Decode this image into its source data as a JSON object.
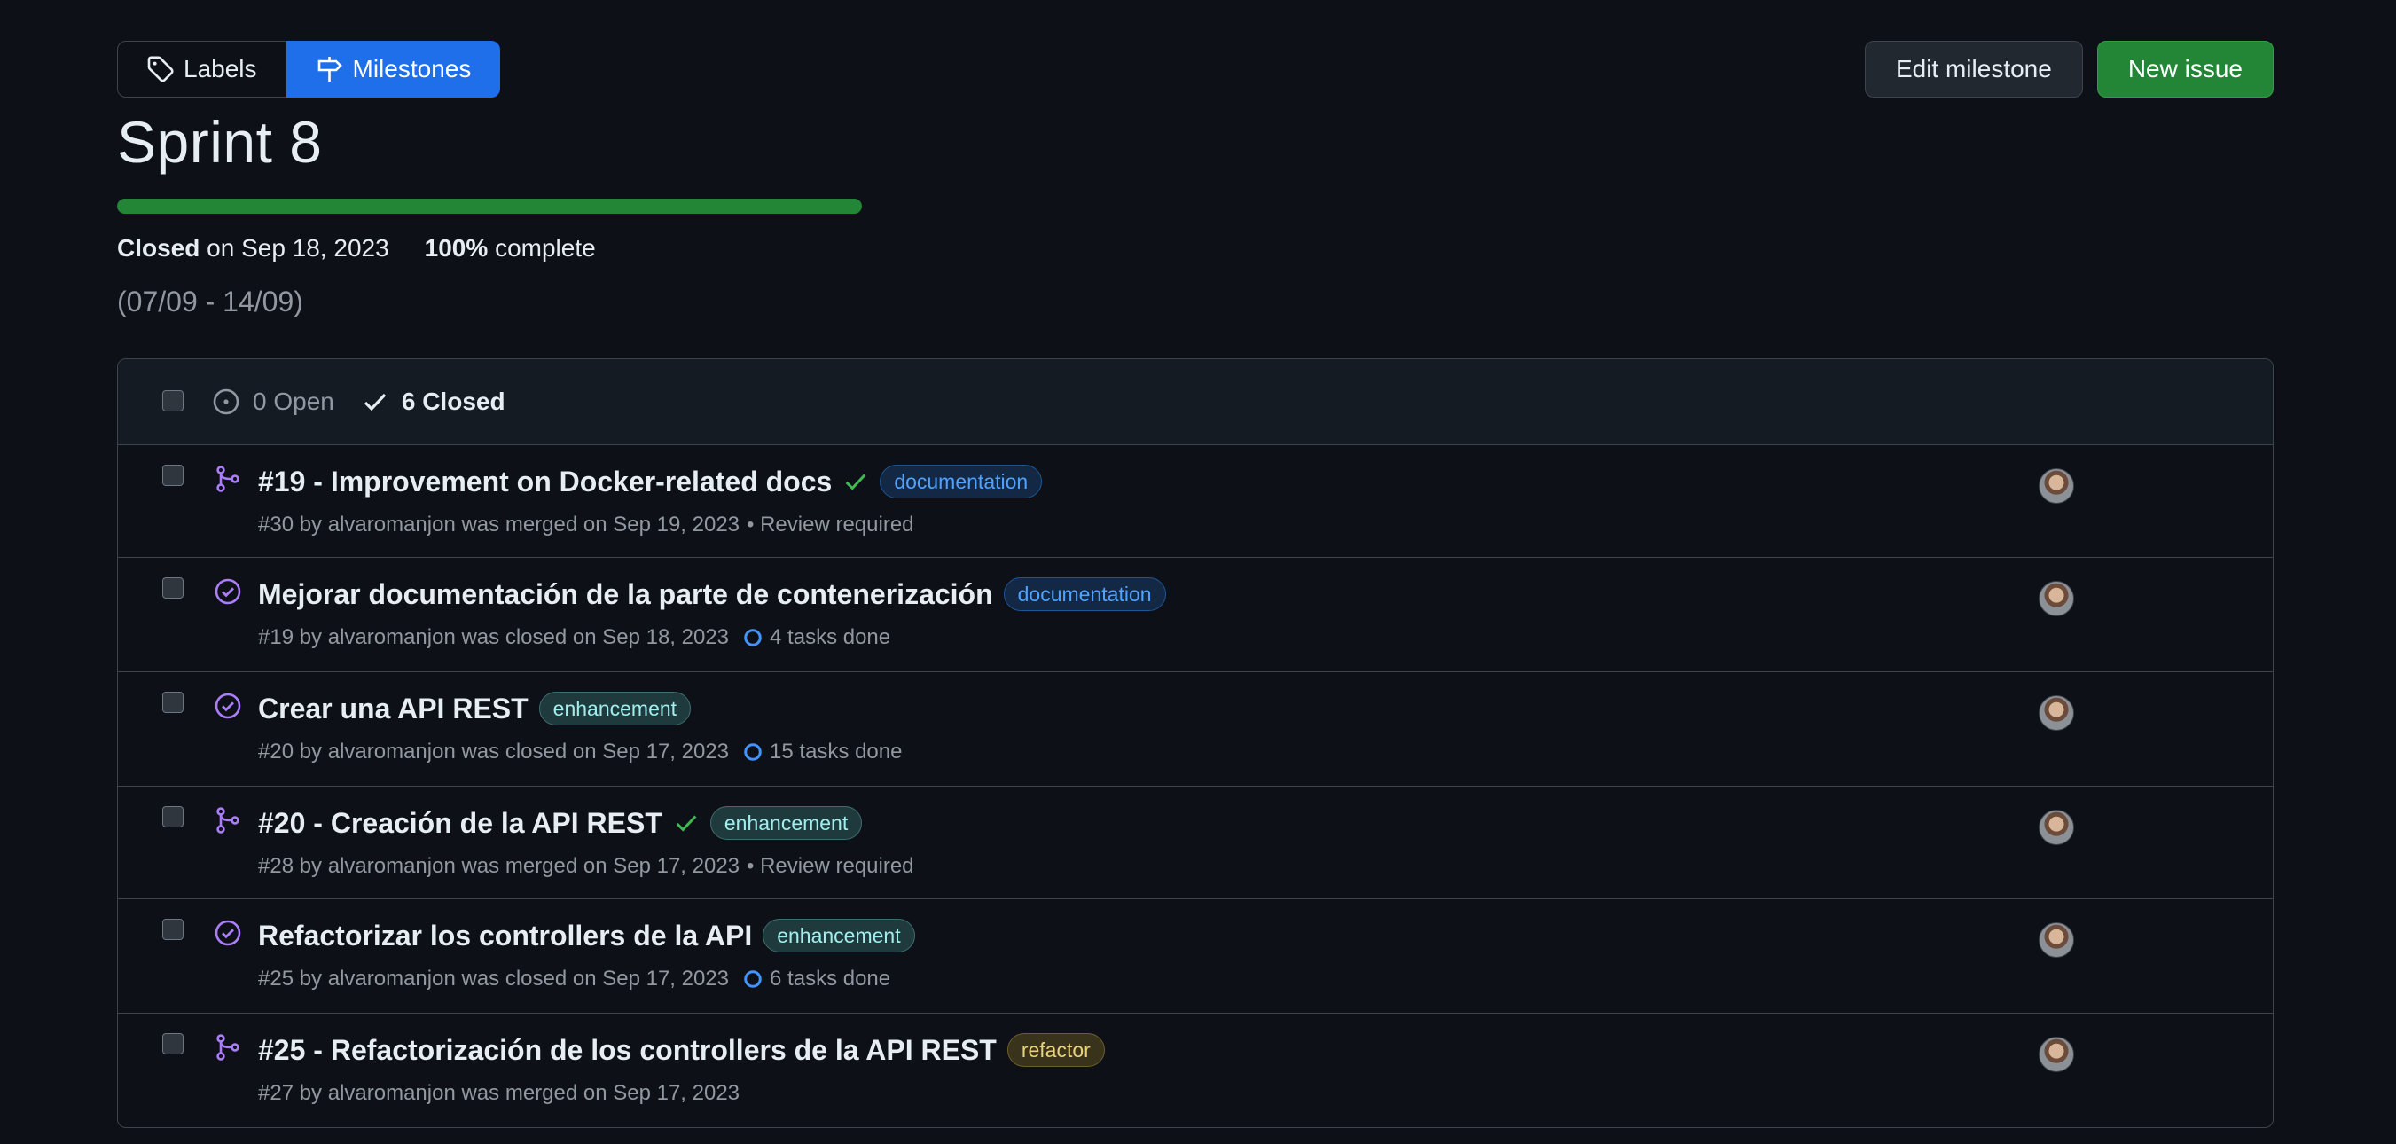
{
  "subnav": {
    "labels": "Labels",
    "milestones": "Milestones"
  },
  "actions": {
    "edit": "Edit milestone",
    "new_issue": "New issue"
  },
  "milestone": {
    "title": "Sprint 8",
    "progress_percent": 100,
    "closed_label": "Closed",
    "closed_on": "on Sep 18, 2023",
    "percent_text": "100%",
    "complete_text": "complete",
    "description": "(07/09 - 14/09)"
  },
  "list_header": {
    "open": "0 Open",
    "closed": "6 Closed"
  },
  "issues": [
    {
      "type": "pr",
      "title": "#19 - Improvement on Docker-related docs",
      "check": true,
      "label": "documentation",
      "label_kind": "doc",
      "meta": "#30 by alvaromanjon was merged on Sep 19, 2023",
      "extra": "• Review required",
      "tasks": ""
    },
    {
      "type": "issue",
      "title": "Mejorar documentación de la parte de contenerización",
      "check": false,
      "label": "documentation",
      "label_kind": "doc",
      "meta": "#19 by alvaromanjon was closed on Sep 18, 2023",
      "extra": "",
      "tasks": "4 tasks done"
    },
    {
      "type": "issue",
      "title": "Crear una API REST",
      "check": false,
      "label": "enhancement",
      "label_kind": "enh",
      "meta": "#20 by alvaromanjon was closed on Sep 17, 2023",
      "extra": "",
      "tasks": "15 tasks done"
    },
    {
      "type": "pr",
      "title": "#20 - Creación de la API REST",
      "check": true,
      "label": "enhancement",
      "label_kind": "enh",
      "meta": "#28 by alvaromanjon was merged on Sep 17, 2023",
      "extra": "• Review required",
      "tasks": ""
    },
    {
      "type": "issue",
      "title": "Refactorizar los controllers de la API",
      "check": false,
      "label": "enhancement",
      "label_kind": "enh",
      "meta": "#25 by alvaromanjon was closed on Sep 17, 2023",
      "extra": "",
      "tasks": "6 tasks done"
    },
    {
      "type": "pr",
      "title": "#25 - Refactorización de los controllers de la API REST",
      "check": false,
      "label": "refactor",
      "label_kind": "ref",
      "meta": "#27 by alvaromanjon was merged on Sep 17, 2023",
      "extra": "",
      "tasks": ""
    }
  ],
  "colors": {
    "accent": "#1f6feb",
    "success": "#238636",
    "merged": "#ab7df8",
    "closed": "#ab7df8"
  }
}
